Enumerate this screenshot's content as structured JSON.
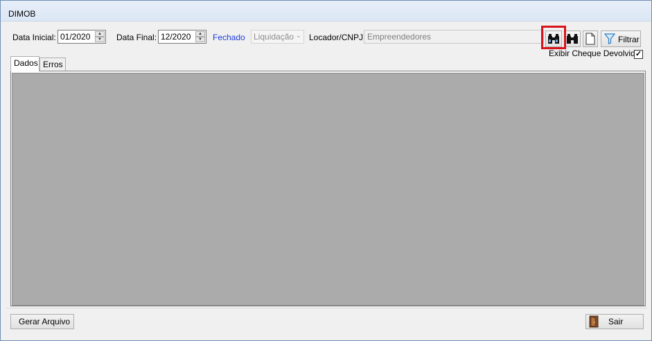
{
  "window": {
    "title": "DIMOB"
  },
  "filters": {
    "data_inicial_label": "Data Inicial:",
    "data_inicial_value": "01/2020",
    "data_final_label": "Data Final:",
    "data_final_value": "12/2020",
    "status_text": "Fechado",
    "status_color": "#1b3cdc",
    "tipo_value": "Liquidação",
    "locador_label": "Locador/CNPJ:",
    "locador_value": "Empreendedores"
  },
  "toolbar": {
    "search_icon": "binoculars-icon",
    "search_all_icon": "binoculars-icon",
    "new_icon": "document-icon",
    "filter_icon": "funnel-icon",
    "filter_label": "Filtrar",
    "highlight_color": "#d9121b"
  },
  "options": {
    "exibir_cheque_label": "Exibir Cheque Devolvido",
    "exibir_cheque_checked": true,
    "check_mark": "✓"
  },
  "tabs": [
    {
      "label": "Dados",
      "active": true
    },
    {
      "label": "Erros",
      "active": false
    }
  ],
  "footer": {
    "gerar_label": "Gerar Arquivo",
    "sair_label": "Sair",
    "sair_icon": "exit-door-icon"
  }
}
